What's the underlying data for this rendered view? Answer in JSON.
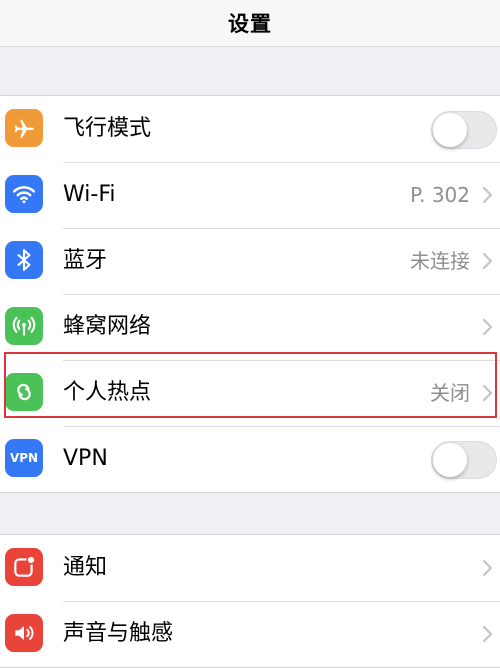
{
  "header": {
    "title": "设置"
  },
  "group1": {
    "items": [
      {
        "label": "飞行模式",
        "type": "toggle",
        "on": false,
        "icon": "airplane-icon",
        "color": "#f19a38"
      },
      {
        "label": "Wi-Fi",
        "type": "value",
        "value": "P. 302",
        "icon": "wifi-icon",
        "color": "#3478f6"
      },
      {
        "label": "蓝牙",
        "type": "value",
        "value": "未连接",
        "icon": "bluetooth-icon",
        "color": "#3478f6"
      },
      {
        "label": "蜂窝网络",
        "type": "chevron",
        "icon": "cellular-icon",
        "color": "#4bc257"
      },
      {
        "label": "个人热点",
        "type": "value",
        "value": "关闭",
        "icon": "hotspot-icon",
        "color": "#4bc257"
      },
      {
        "label": "VPN",
        "type": "toggle",
        "on": false,
        "icon": "vpn-icon",
        "icon_text": "VPN",
        "color": "#3478f6"
      }
    ]
  },
  "group2": {
    "items": [
      {
        "label": "通知",
        "type": "chevron",
        "icon": "notification-icon",
        "color": "#e9443a"
      },
      {
        "label": "声音与触感",
        "type": "chevron",
        "icon": "sound-icon",
        "color": "#e9443a"
      }
    ]
  },
  "colors": {
    "highlight": "#d9363e",
    "secondary_text": "#8e8e93",
    "background": "#efeff4"
  }
}
